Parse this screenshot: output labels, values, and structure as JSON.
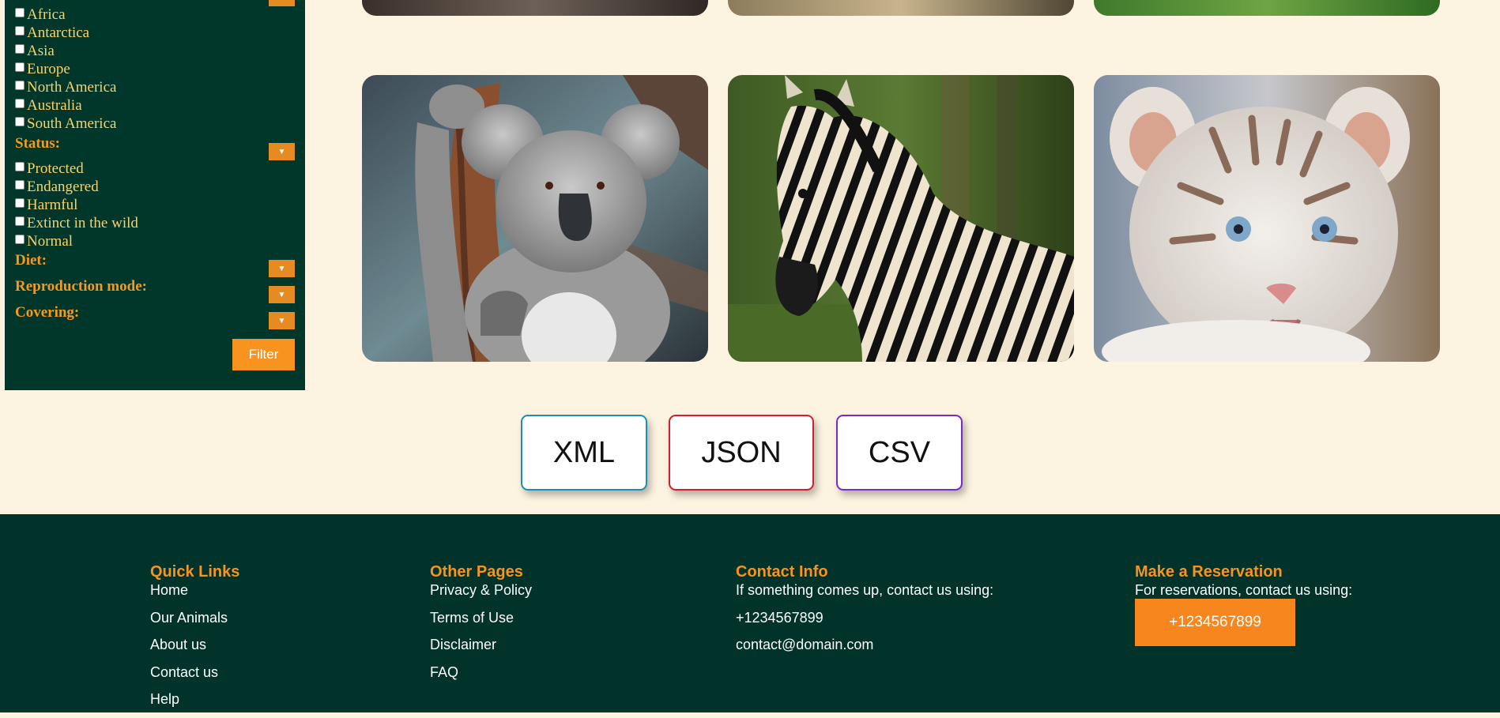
{
  "sidebar": {
    "continents": [
      "Africa",
      "Antarctica",
      "Asia",
      "Europe",
      "North America",
      "Australia",
      "South America"
    ],
    "status_label": "Status:",
    "statuses": [
      "Protected",
      "Endangered",
      "Harmful",
      "Extinct in the wild",
      "Normal"
    ],
    "diet_label": "Diet:",
    "reproduction_label": "Reproduction mode:",
    "covering_label": "Covering:",
    "dropdown_glyph": "▼",
    "filter_label": "Filter"
  },
  "gallery": {
    "animals": [
      "koala",
      "zebra",
      "white tiger cub"
    ]
  },
  "export": {
    "xml": "XML",
    "json": "JSON",
    "csv": "CSV",
    "colors": {
      "xml": "#1a8fb3",
      "json": "#d21f2b",
      "csv": "#7a2ac8"
    }
  },
  "footer": {
    "quick_links": {
      "title": "Quick Links",
      "items": [
        "Home",
        "Our Animals",
        "About us",
        "Contact us",
        "Help"
      ]
    },
    "other_pages": {
      "title": "Other Pages",
      "items": [
        "Privacy & Policy",
        "Terms of Use",
        "Disclaimer",
        "FAQ"
      ]
    },
    "contact_info": {
      "title": "Contact Info",
      "intro": "If something comes up, contact us using:",
      "phone": "+1234567899",
      "email": "contact@domain.com"
    },
    "reservation": {
      "title": "Make a Reservation",
      "intro": "For reservations, contact us using:",
      "phone_button": "+1234567899"
    }
  },
  "colors": {
    "accent": "#f7931e",
    "dark_green": "#01362a",
    "page_bg": "#fdf3e1"
  }
}
